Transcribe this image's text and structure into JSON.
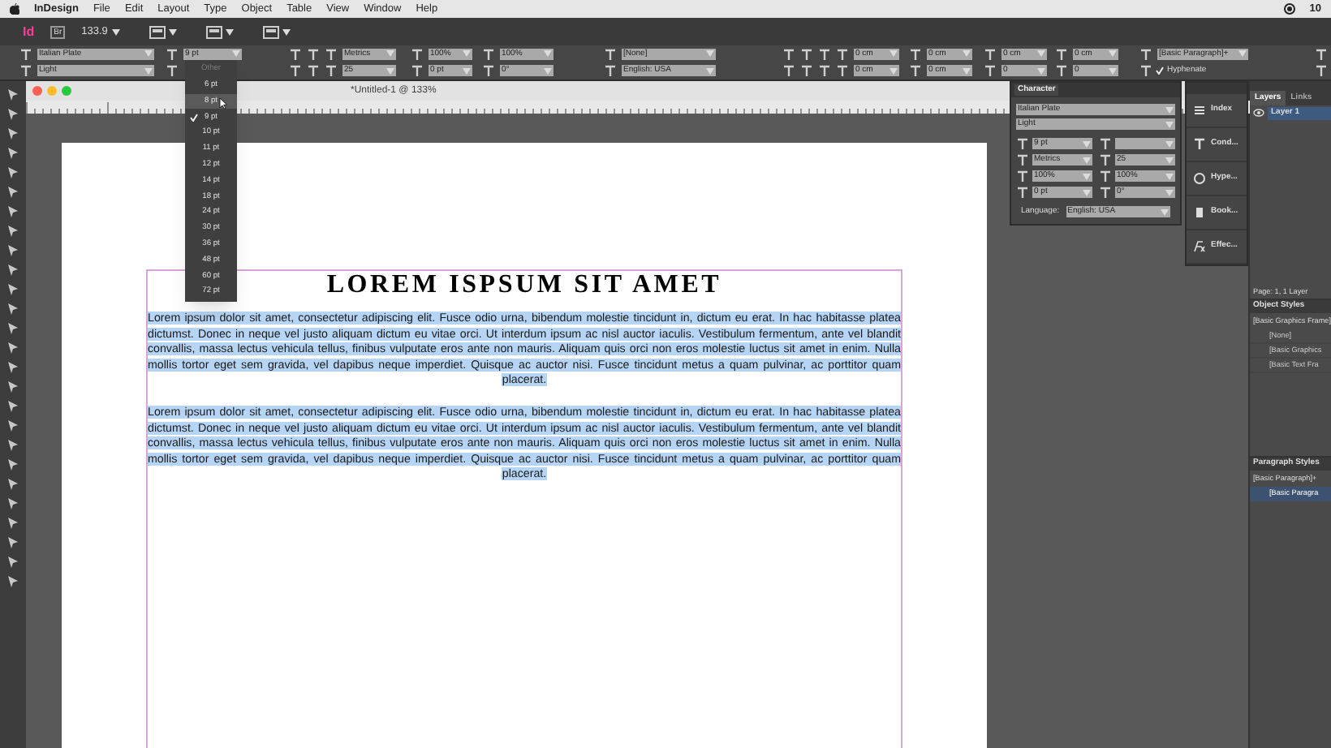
{
  "menu_bar": {
    "app_name": "InDesign",
    "items": [
      "File",
      "Edit",
      "Layout",
      "Type",
      "Object",
      "Table",
      "View",
      "Window",
      "Help"
    ],
    "status_text": "10"
  },
  "app_bar": {
    "logo": "Id",
    "bridge": "Br",
    "zoom": "133.9"
  },
  "control_bar": {
    "row_1": [
      {
        "value": "Italian Plate"
      },
      {
        "value": "9 pt"
      },
      {
        "value": "Metrics"
      },
      {
        "value": "100%"
      },
      {
        "value": "100%"
      },
      {
        "value": "[None]"
      },
      {
        "value": "0 cm"
      },
      {
        "value": "0 cm"
      },
      {
        "value": "0 cm"
      },
      {
        "value": "0 cm"
      },
      {
        "value": "[Basic Paragraph]+"
      }
    ],
    "row_2": [
      {
        "value": "Light"
      },
      {
        "value": "25"
      },
      {
        "value": "0 pt"
      },
      {
        "value": "0°"
      },
      {
        "value": "English: USA"
      },
      {
        "value": "0 cm"
      },
      {
        "value": "0 cm"
      },
      {
        "value": "0"
      },
      {
        "value": "0"
      }
    ],
    "hyphenate": {
      "label": "Hyphenate",
      "checked": true
    }
  },
  "size_menu": [
    {
      "label": "Other",
      "disabled": true,
      "checked": false,
      "highlighted": false
    },
    {
      "label": "6 pt",
      "disabled": false,
      "checked": false,
      "highlighted": false
    },
    {
      "label": "8 pt",
      "disabled": false,
      "checked": false,
      "highlighted": true
    },
    {
      "label": "9 pt",
      "disabled": false,
      "checked": true,
      "highlighted": false
    },
    {
      "label": "10 pt",
      "disabled": false,
      "checked": false,
      "highlighted": false
    },
    {
      "label": "11 pt",
      "disabled": false,
      "checked": false,
      "highlighted": false
    },
    {
      "label": "12 pt",
      "disabled": false,
      "checked": false,
      "highlighted": false
    },
    {
      "label": "14 pt",
      "disabled": false,
      "checked": false,
      "highlighted": false
    },
    {
      "label": "18 pt",
      "disabled": false,
      "checked": false,
      "highlighted": false
    },
    {
      "label": "24 pt",
      "disabled": false,
      "checked": false,
      "highlighted": false
    },
    {
      "label": "30 pt",
      "disabled": false,
      "checked": false,
      "highlighted": false
    },
    {
      "label": "36 pt",
      "disabled": false,
      "checked": false,
      "highlighted": false
    },
    {
      "label": "48 pt",
      "disabled": false,
      "checked": false,
      "highlighted": false
    },
    {
      "label": "60 pt",
      "disabled": false,
      "checked": false,
      "highlighted": false
    },
    {
      "label": "72 pt",
      "disabled": false,
      "checked": false,
      "highlighted": false
    }
  ],
  "document": {
    "title": "*Untitled-1 @ 133%",
    "heading": "LOREM ISPSUM SIT AMET",
    "paragraphs": [
      "Lorem ipsum dolor sit amet, consectetur adipiscing elit. Fusce odio urna, bibendum molestie tincidunt in, dictum eu erat. In hac habitasse platea dictumst. Donec in neque vel justo aliquam dictum eu vitae orci. Ut interdum ipsum ac nisl auctor iaculis. Vestibulum fermentum, ante vel blandit convallis, massa lectus vehicula tellus, finibus vulputate eros ante non mauris. Aliquam quis orci non eros molestie luctus sit amet in enim. Nulla mollis tortor eget sem gravida, vel dapibus neque imperdiet. Quisque ac auctor nisi. Fusce tincidunt metus a quam pulvinar, ac porttitor quam placerat.",
      "Lorem ipsum dolor sit amet, consectetur adipiscing elit. Fusce odio urna, bibendum molestie tincidunt in, dictum eu erat. In hac habitasse platea dictumst. Donec in neque vel justo aliquam dictum eu vitae orci. Ut interdum ipsum ac nisl auctor iaculis. Vestibulum fermentum, ante vel blandit convallis, massa lectus vehicula tellus, finibus vulputate eros ante non mauris. Aliquam quis orci non eros molestie luctus sit amet in enim. Nulla mollis tortor eget sem gravida, vel dapibus neque imperdiet. Quisque ac auctor nisi. Fusce tincidunt metus a quam pulvinar, ac porttitor quam placerat."
    ]
  },
  "character_panel": {
    "title": "Character",
    "font": "Italian Plate",
    "style": "Light",
    "fields": [
      {
        "kind": "field",
        "value": "9 pt"
      },
      {
        "kind": "empty"
      },
      {
        "kind": "field",
        "value": "Metrics"
      },
      {
        "kind": "field",
        "value": "25"
      },
      {
        "kind": "field",
        "value": "100%"
      },
      {
        "kind": "field",
        "value": "100%"
      },
      {
        "kind": "field",
        "value": "0 pt"
      },
      {
        "kind": "field",
        "value": "0°"
      }
    ],
    "language_label": "Language:",
    "language": "English: USA"
  },
  "tool_panel": {
    "items": [
      "Index",
      "Cond...",
      "Hype...",
      "Book...",
      "Effec..."
    ]
  },
  "layers_panel": {
    "tabs": [
      {
        "label": "Layers",
        "selected": true
      },
      {
        "label": "Links",
        "selected": false
      }
    ],
    "layers": [
      {
        "name": "Layer 1",
        "visible": true
      }
    ],
    "footer": "Page: 1, 1 Layer"
  },
  "object_styles": {
    "title": "Object Styles",
    "default": "[Basic Graphics Frame]",
    "items": [
      {
        "label": "[None]",
        "selected": false
      },
      {
        "label": "[Basic Graphics",
        "selected": false
      },
      {
        "label": "[Basic Text Fra",
        "selected": false
      }
    ]
  },
  "paragraph_styles": {
    "title": "Paragraph Styles",
    "default": "[Basic Paragraph]+",
    "items": [
      {
        "label": "[Basic Paragra",
        "selected": true
      }
    ]
  }
}
